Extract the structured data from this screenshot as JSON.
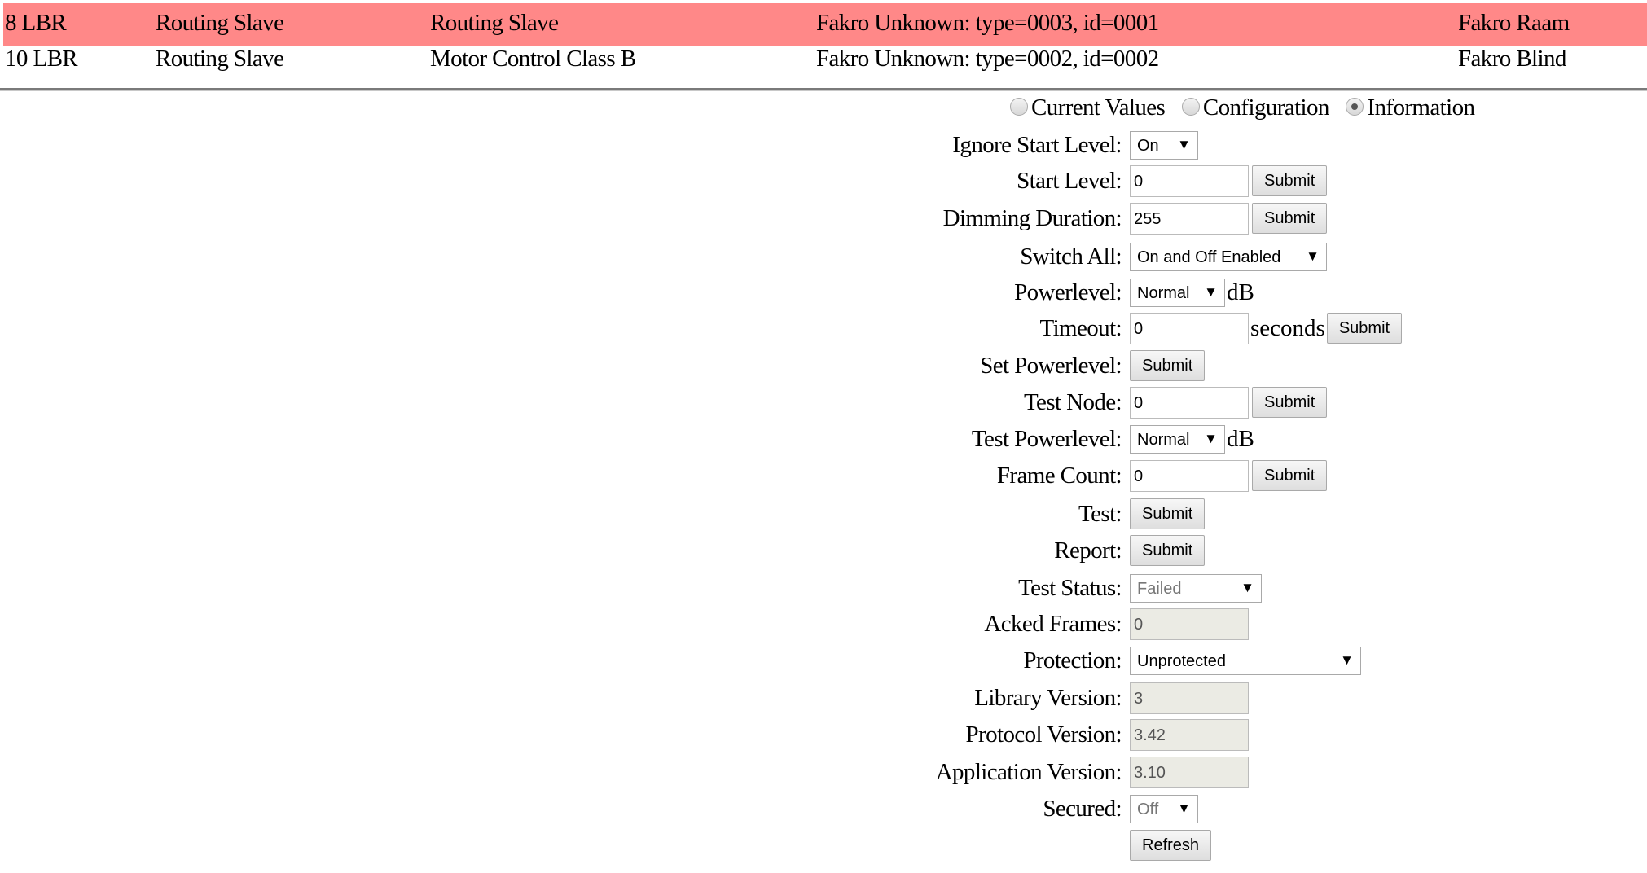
{
  "nodes": [
    {
      "id": "8 LBR",
      "basic": "Routing Slave",
      "generic": "Routing Slave",
      "product": "Fakro Unknown: type=0003, id=0001",
      "name": "Fakro Raam",
      "selected": true
    },
    {
      "id": "10 LBR",
      "basic": "Routing Slave",
      "generic": "Motor Control Class B",
      "product": "Fakro Unknown: type=0002, id=0002",
      "name": "Fakro Blind",
      "selected": false
    }
  ],
  "colors": {
    "selected_row": "#ff8888"
  },
  "view": {
    "options": [
      "Current Values",
      "Configuration",
      "Information"
    ],
    "selected": "Information"
  },
  "form": {
    "submit": "Submit",
    "refresh": "Refresh",
    "db": "dB",
    "seconds": "seconds",
    "ignore_start_level": {
      "label": "Ignore Start Level:",
      "value": "On"
    },
    "start_level": {
      "label": "Start Level:",
      "value": "0"
    },
    "dimming_duration": {
      "label": "Dimming Duration:",
      "value": "255"
    },
    "switch_all": {
      "label": "Switch All:",
      "value": "On and Off Enabled"
    },
    "powerlevel": {
      "label": "Powerlevel:",
      "value": "Normal"
    },
    "timeout": {
      "label": "Timeout:",
      "value": "0"
    },
    "set_powerlevel": {
      "label": "Set Powerlevel:"
    },
    "test_node": {
      "label": "Test Node:",
      "value": "0"
    },
    "test_powerlevel": {
      "label": "Test Powerlevel:",
      "value": "Normal"
    },
    "frame_count": {
      "label": "Frame Count:",
      "value": "0"
    },
    "test": {
      "label": "Test:"
    },
    "report": {
      "label": "Report:"
    },
    "test_status": {
      "label": "Test Status:",
      "value": "Failed"
    },
    "acked_frames": {
      "label": "Acked Frames:",
      "value": "0"
    },
    "protection": {
      "label": "Protection:",
      "value": "Unprotected"
    },
    "library_version": {
      "label": "Library Version:",
      "value": "3"
    },
    "protocol_version": {
      "label": "Protocol Version:",
      "value": "3.42"
    },
    "application_version": {
      "label": "Application Version:",
      "value": "3.10"
    },
    "secured": {
      "label": "Secured:",
      "value": "Off"
    }
  }
}
